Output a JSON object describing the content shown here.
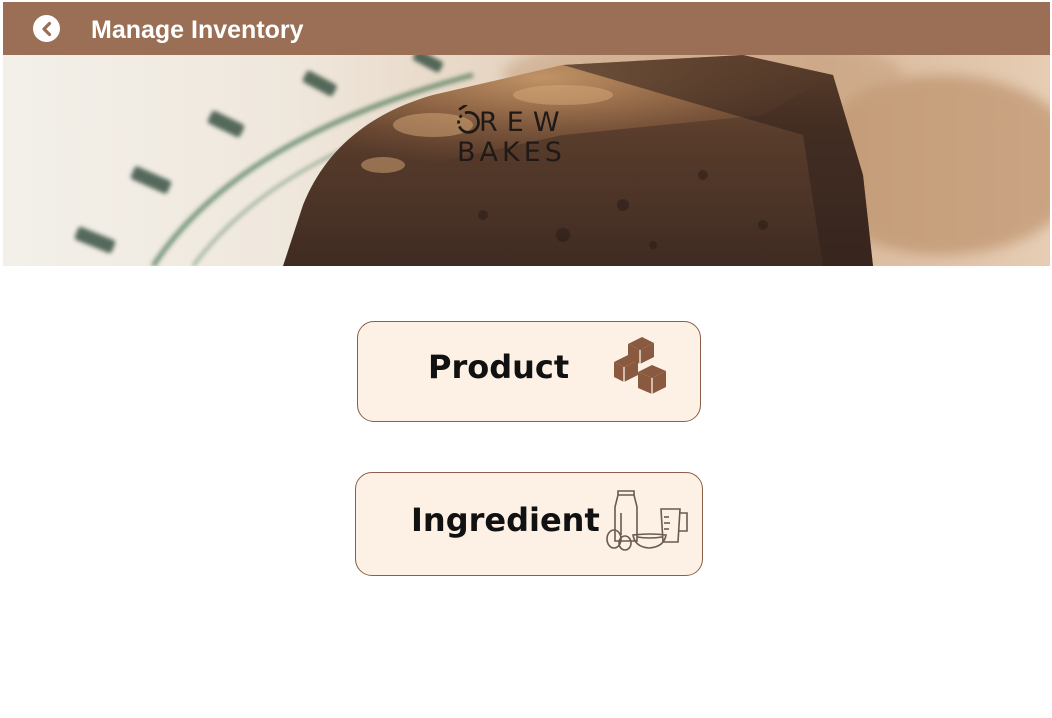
{
  "header": {
    "title": "Manage Inventory",
    "back_icon": "chevron-left-circle-icon",
    "background_color": "#9a6f55"
  },
  "hero": {
    "logo": {
      "line1": "REW",
      "line2": "BAKES",
      "full_text": "DREW BAKES"
    },
    "image": "brownie-on-plate"
  },
  "menu": {
    "items": [
      {
        "label": "Product",
        "icon": "boxes-icon"
      },
      {
        "label": "Ingredient",
        "icon": "ingredients-icon"
      }
    ],
    "button_fill": "#fdf0e4",
    "button_border": "#8a6048",
    "icon_color": "#8a5a40"
  }
}
